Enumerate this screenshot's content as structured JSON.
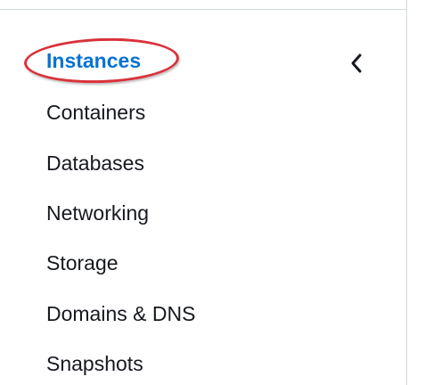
{
  "sidebar": {
    "items": [
      {
        "label": "Instances",
        "active": true
      },
      {
        "label": "Containers",
        "active": false
      },
      {
        "label": "Databases",
        "active": false
      },
      {
        "label": "Networking",
        "active": false
      },
      {
        "label": "Storage",
        "active": false
      },
      {
        "label": "Domains & DNS",
        "active": false
      },
      {
        "label": "Snapshots",
        "active": false
      }
    ],
    "collapse_icon": "chevron-left-icon",
    "annotation_color": "#d9323a"
  },
  "colors": {
    "active_link": "#0972d3",
    "text": "#16191f",
    "divider": "#d5dbdb"
  }
}
